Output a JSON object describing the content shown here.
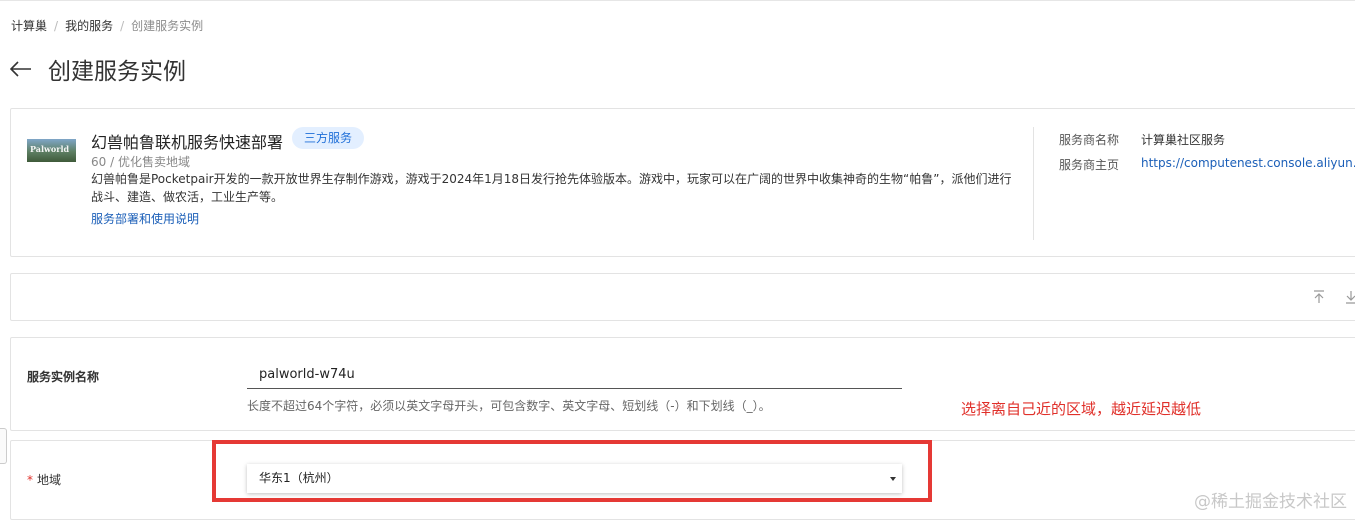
{
  "breadcrumb": {
    "items": [
      "计算巢",
      "我的服务"
    ],
    "separator": "/",
    "current": "创建服务实例"
  },
  "header": {
    "back_icon": "arrow-left-icon",
    "title": "创建服务实例"
  },
  "service": {
    "thumbnail_text": "Palworld",
    "name": "幻兽帕鲁联机服务快速部署",
    "tag": "三方服务",
    "subtitle": "60 / 优化售卖地域",
    "description": "幻兽帕鲁是Pocketpair开发的一款开放世界生存制作游戏，游戏于2024年1月18日发行抢先体验版本。游戏中，玩家可以在广阔的世界中收集神奇的生物“帕鲁”，派他们进行战斗、建造、做农活，工业生产等。",
    "doc_link": "服务部署和使用说明",
    "provider_name_label": "服务商名称",
    "provider_name": "计算巢社区服务",
    "provider_home_label": "服务商主页",
    "provider_home": "https://computenest.console.aliyun.com"
  },
  "toolbar": {
    "icons": [
      "scroll-to-top-icon",
      "download-icon"
    ]
  },
  "form": {
    "instance_name_label": "服务实例名称",
    "instance_name_value": "palworld-w74u",
    "instance_name_help": "长度不超过64个字符，必须以英文字母开头，可包含数字、英文字母、短划线（-）和下划线（_）。",
    "annotation": "选择离自己近的区域，越近延迟越低",
    "required_mark": "*",
    "region_label": "地域",
    "region_value": "华东1（杭州）"
  },
  "colors": {
    "link": "#1b5fb8",
    "tag_bg": "#e3efff",
    "annotation_red": "#e0302a",
    "highlight_border": "#e53935"
  },
  "watermark": "@稀土掘金技术社区"
}
